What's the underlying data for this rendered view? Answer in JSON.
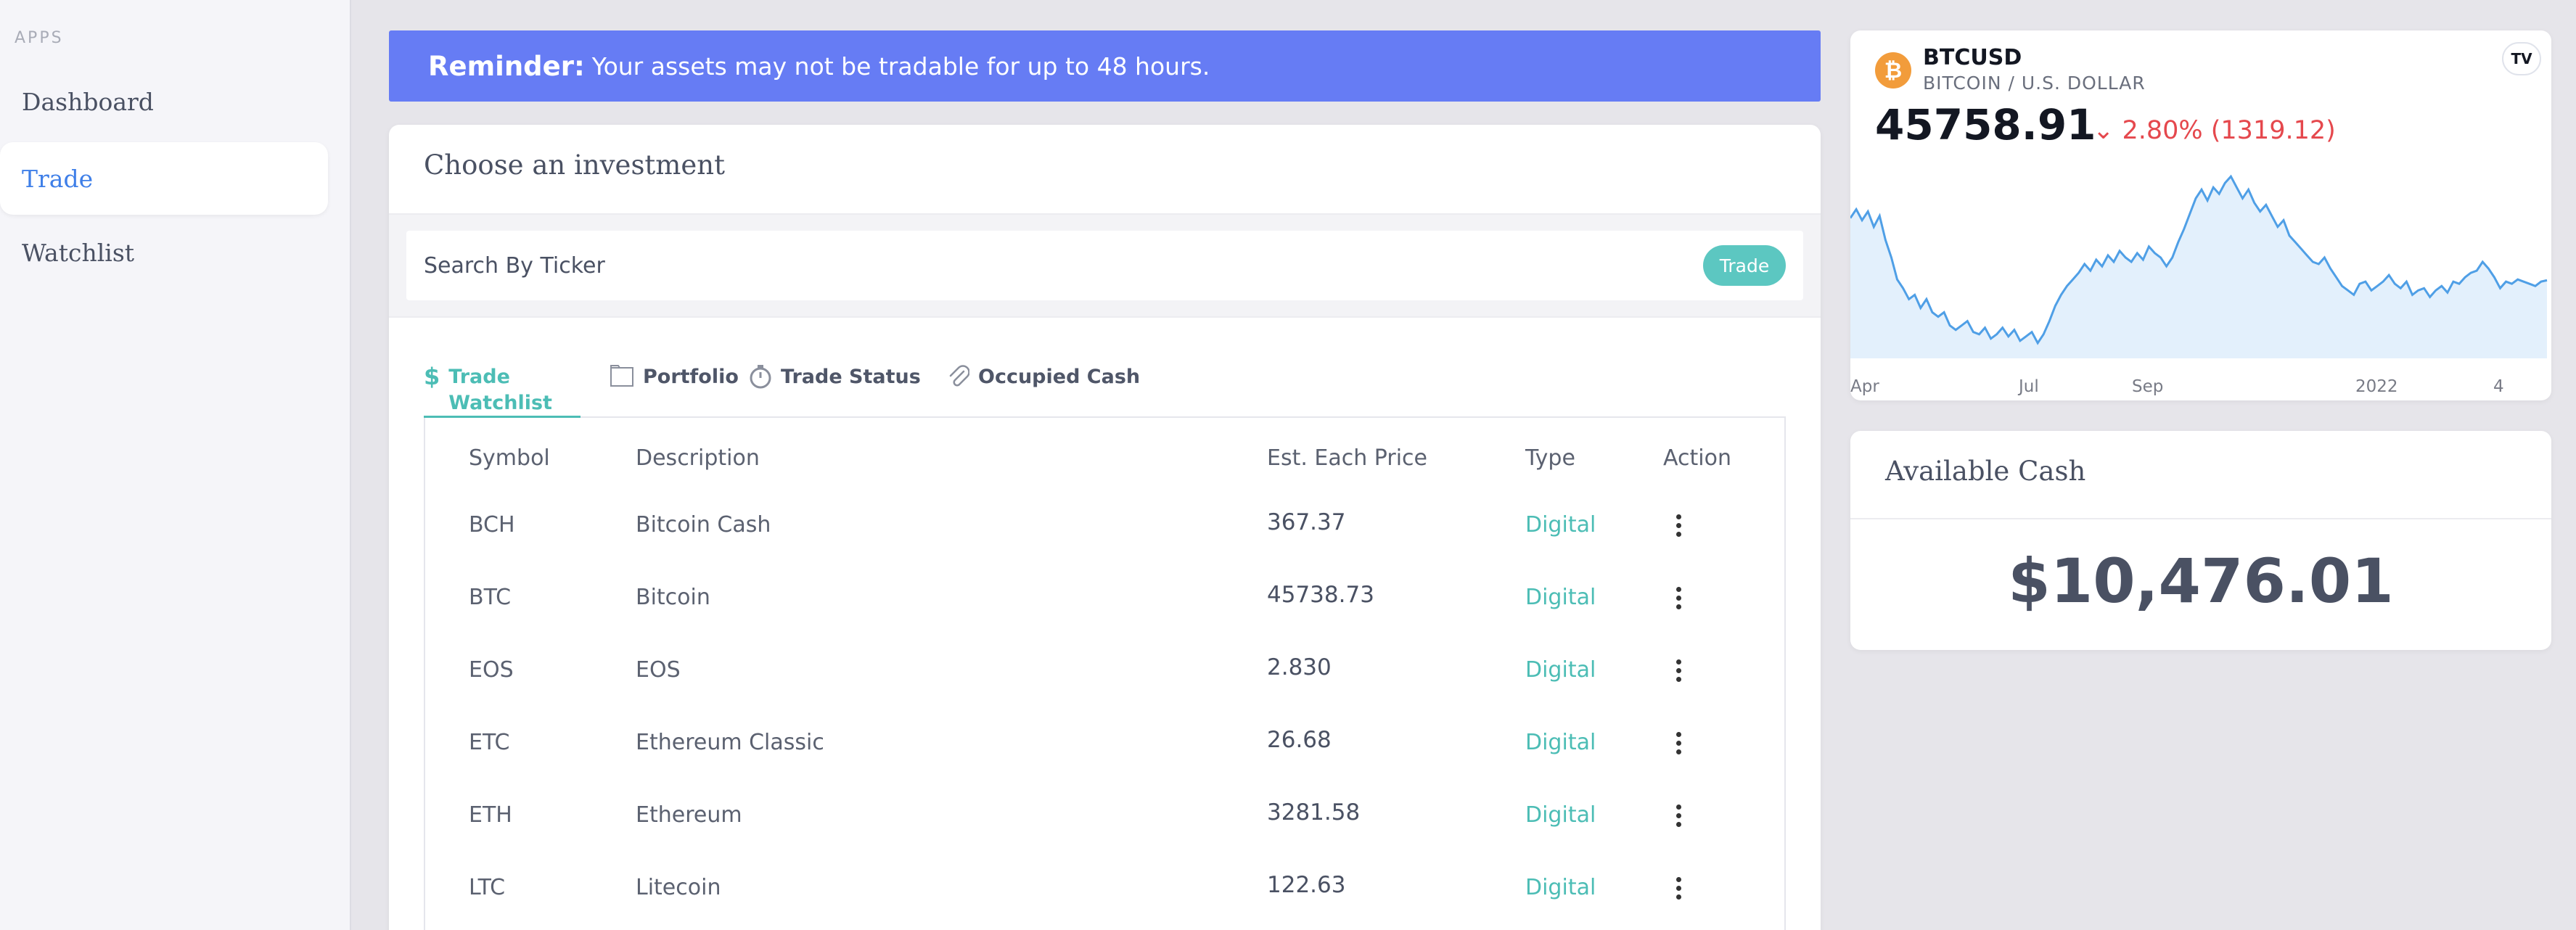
{
  "sidebar": {
    "section_label": "APPS",
    "items": [
      {
        "label": "Dashboard",
        "active": false
      },
      {
        "label": "Trade",
        "active": true
      },
      {
        "label": "Watchlist",
        "active": false
      }
    ]
  },
  "reminder": {
    "title": "Reminder:",
    "text": "Your assets may not be tradable for up to 48 hours."
  },
  "investment": {
    "title": "Choose an investment",
    "search_placeholder": "Search By Ticker",
    "search_button": "Trade",
    "tabs": [
      {
        "label": "Trade Watchlist",
        "icon": "dollar-icon",
        "active": true
      },
      {
        "label": "Portfolio",
        "icon": "folder-icon",
        "active": false
      },
      {
        "label": "Trade Status",
        "icon": "stopwatch-icon",
        "active": false
      },
      {
        "label": "Occupied Cash",
        "icon": "paperclip-icon",
        "active": false
      }
    ],
    "columns": [
      "Symbol",
      "Description",
      "Est. Each Price",
      "Type",
      "Action"
    ],
    "rows": [
      {
        "symbol": "BCH",
        "description": "Bitcoin Cash",
        "price": "367.37",
        "type": "Digital"
      },
      {
        "symbol": "BTC",
        "description": "Bitcoin",
        "price": "45738.73",
        "type": "Digital"
      },
      {
        "symbol": "EOS",
        "description": "EOS",
        "price": "2.830",
        "type": "Digital"
      },
      {
        "symbol": "ETC",
        "description": "Ethereum Classic",
        "price": "26.68",
        "type": "Digital"
      },
      {
        "symbol": "ETH",
        "description": "Ethereum",
        "price": "3281.58",
        "type": "Digital"
      },
      {
        "symbol": "LTC",
        "description": "Litecoin",
        "price": "122.63",
        "type": "Digital"
      }
    ]
  },
  "ticker": {
    "coin_glyph": "₿",
    "symbol": "BTCUSD",
    "pair": "BITCOIN / U.S. DOLLAR",
    "tv_logo": "TV",
    "price": "45758.91",
    "change": "⌄ 2.80% (1319.12)",
    "colors": {
      "line": "#4f9fe6",
      "fill": "#e3f0fc",
      "down": "#e5484d"
    }
  },
  "cash": {
    "title": "Available Cash",
    "amount": "$10,476.01"
  },
  "chart_data": {
    "type": "area",
    "title": "",
    "xlabel": "",
    "ylabel": "",
    "x_ticks": [
      "Apr",
      "Jul",
      "Sep",
      "2022",
      "4"
    ],
    "y": [
      57000,
      59000,
      56500,
      58500,
      55000,
      57500,
      52000,
      48000,
      43000,
      41000,
      38500,
      39500,
      36500,
      38500,
      35500,
      34500,
      35500,
      32500,
      31500,
      32500,
      33500,
      31000,
      30500,
      32000,
      29500,
      30500,
      32000,
      30000,
      31500,
      29000,
      30000,
      31000,
      28500,
      30500,
      33500,
      37000,
      39500,
      41500,
      43000,
      44500,
      46500,
      45000,
      47500,
      46000,
      48500,
      47000,
      49500,
      48000,
      47000,
      49000,
      47500,
      50500,
      49000,
      48000,
      46000,
      48000,
      51500,
      54500,
      58000,
      61500,
      63500,
      61000,
      64000,
      62500,
      65000,
      66500,
      64000,
      61500,
      63500,
      60500,
      58500,
      60000,
      57500,
      55000,
      56500,
      53000,
      51500,
      50000,
      48500,
      47000,
      46500,
      48000,
      45500,
      43500,
      41500,
      40500,
      39500,
      42000,
      42500,
      40500,
      41500,
      42500,
      44000,
      42000,
      41000,
      42500,
      39500,
      40500,
      41000,
      39000,
      40500,
      41500,
      40000,
      42500,
      42000,
      43500,
      44500,
      45000,
      47000,
      45500,
      43500,
      41000,
      42500,
      42000,
      43000,
      42500,
      42000,
      41500,
      42500,
      42800
    ]
  }
}
